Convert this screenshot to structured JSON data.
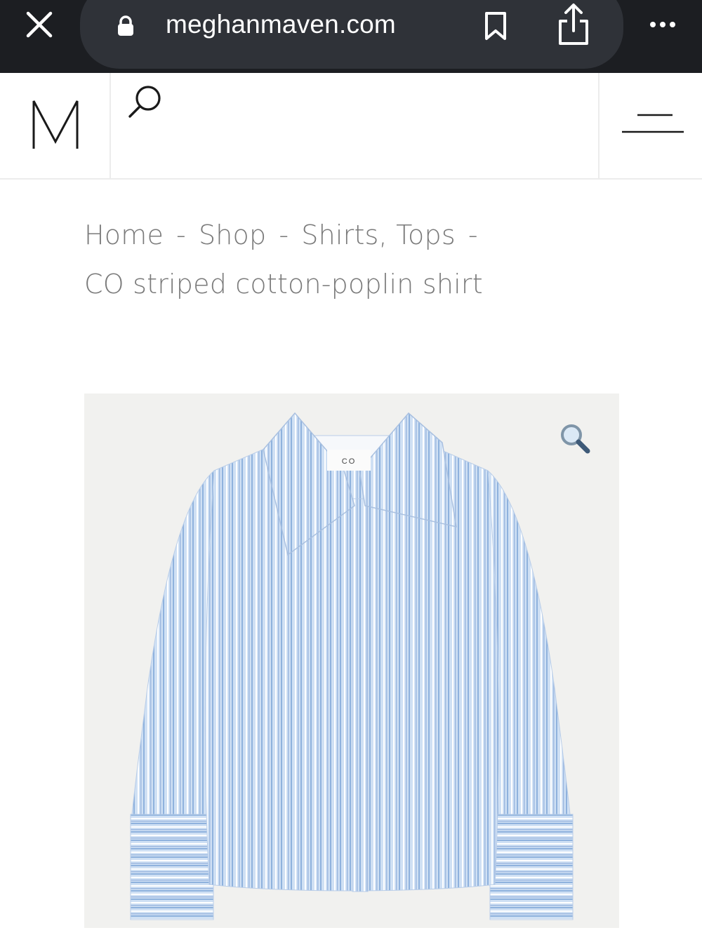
{
  "browser": {
    "url": "meghanmaven.com",
    "icons": [
      "close-icon",
      "lock-icon",
      "bookmark-icon",
      "share-icon",
      "more-icon"
    ]
  },
  "site": {
    "logo_letter": "M",
    "icons": [
      "search-icon",
      "menu-icon"
    ]
  },
  "breadcrumb": {
    "items": [
      "Home",
      "Shop",
      "Shirts, Tops"
    ],
    "separator": "-",
    "current": "CO striped cotton-poplin shirt"
  },
  "product": {
    "label_tag": "CO",
    "zoom_icon": "magnifier-icon"
  },
  "colors": {
    "chrome_bg": "#1c1e22",
    "url_pill": "#2f3238",
    "breadcrumb_text": "#7a7a7a",
    "shirt_base": "#c9dcf2",
    "stripe": "#8fb2dd"
  }
}
